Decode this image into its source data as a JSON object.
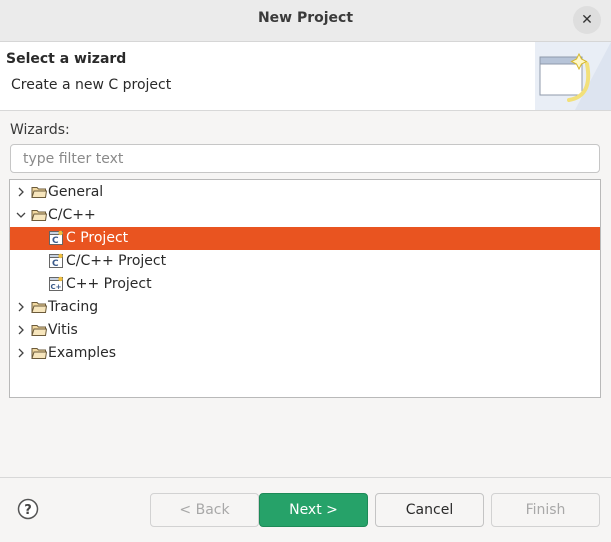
{
  "window": {
    "title": "New Project"
  },
  "header": {
    "title": "Select a wizard",
    "description": "Create a new C project"
  },
  "wizards": {
    "label": "Wizards:",
    "filter_placeholder": "type filter text",
    "items": [
      {
        "label": "General",
        "type": "folder",
        "expanded": false,
        "selected": false
      },
      {
        "label": "C/C++",
        "type": "folder",
        "expanded": true,
        "selected": false
      },
      {
        "label": "C Project",
        "type": "c-project",
        "selected": true
      },
      {
        "label": "C/C++ Project",
        "type": "c-project",
        "selected": false
      },
      {
        "label": "C++ Project",
        "type": "cpp-project",
        "selected": false
      },
      {
        "label": "Tracing",
        "type": "folder",
        "expanded": false,
        "selected": false
      },
      {
        "label": "Vitis",
        "type": "folder",
        "expanded": false,
        "selected": false
      },
      {
        "label": "Examples",
        "type": "folder",
        "expanded": false,
        "selected": false
      }
    ]
  },
  "buttons": {
    "back": "< Back",
    "next": "Next >",
    "cancel": "Cancel",
    "finish": "Finish"
  },
  "colors": {
    "selection": "#e95420",
    "primary": "#26a269"
  }
}
